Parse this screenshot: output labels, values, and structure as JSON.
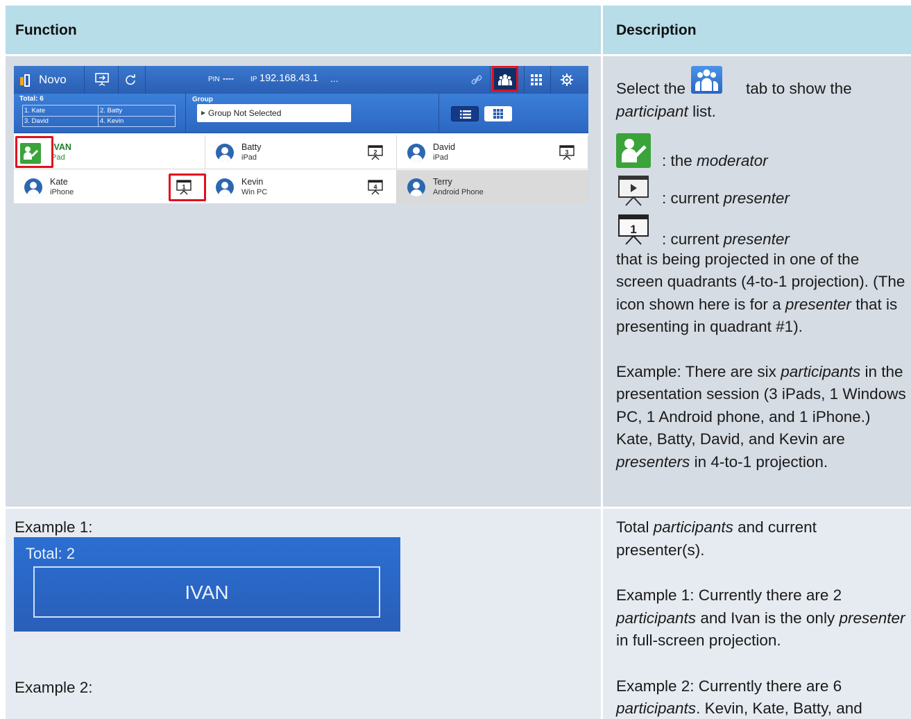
{
  "table": {
    "headers": {
      "function": "Function",
      "description": "Description"
    }
  },
  "app": {
    "brand": "Novo",
    "pin_label": "PIN",
    "pin_value": "----",
    "ip_label": "IP",
    "ip_value": "192.168.43.1",
    "more": "...",
    "total_label": "Total: 6",
    "presenters_grid": [
      "1. Kate",
      "2. Batty",
      "3. David",
      "4. Kevin"
    ],
    "group_label": "Group",
    "group_value": "Group Not Selected",
    "participants": [
      {
        "name": "IVAN",
        "device": "Pad",
        "role": "moderator"
      },
      {
        "name": "Batty",
        "device": "iPad",
        "quadrant": "2"
      },
      {
        "name": "David",
        "device": "iPad",
        "quadrant": "3"
      },
      {
        "name": "Kate",
        "device": "iPhone",
        "quadrant": "1"
      },
      {
        "name": "Kevin",
        "device": "Win PC",
        "quadrant": "4"
      },
      {
        "name": "Terry",
        "device": "Android Phone"
      }
    ],
    "colors": {
      "bar": "#2a5eb3",
      "highlight": "#e0101e",
      "moderator": "#3aa33a"
    }
  },
  "row1_desc": {
    "select_pre": "Select the",
    "select_post": "tab to show the",
    "participant_word": "participant",
    "list_word": " list.",
    "moderator_pre": ": the ",
    "moderator_word": "moderator",
    "presenter_pre": ": current ",
    "presenter_word": "presenter",
    "quad_pre": ": current ",
    "quad_word": "presenter",
    "quad_post": " that is being projected in one of the screen quadrants (4-to-1 projection). (The icon shown here is for a ",
    "quad_word2": "presenter",
    "quad_post2": " that is presenting in quadrant #1).",
    "ex_pre": "Example: There are six ",
    "ex_word": "participants",
    "ex_mid": " in the presentation session (3 iPads, 1 Windows PC, 1 Android phone, and 1 iPhone.) Kate, Batty, David, and Kevin are ",
    "ex_word2": "presenters",
    "ex_post": " in 4-to-1 projection.",
    "quad_icon_number": "1"
  },
  "row2": {
    "example1_label": "Example 1:",
    "example2_label": "Example 2:",
    "panel_total": "Total: 2",
    "panel_name": "IVAN",
    "desc_total_pre": "Total ",
    "desc_total_word": "participants",
    "desc_total_post": " and current presenter(s).",
    "ex1_pre": "Example 1: Currently there are 2 ",
    "ex1_word": "participants",
    "ex1_mid": " and Ivan is the only ",
    "ex1_word2": "presenter",
    "ex1_post": " in full-screen projection.",
    "ex2_pre": "Example 2: Currently there are 6 ",
    "ex2_word": "participants",
    "ex2_post": ". Kevin, Kate, Batty, and"
  }
}
